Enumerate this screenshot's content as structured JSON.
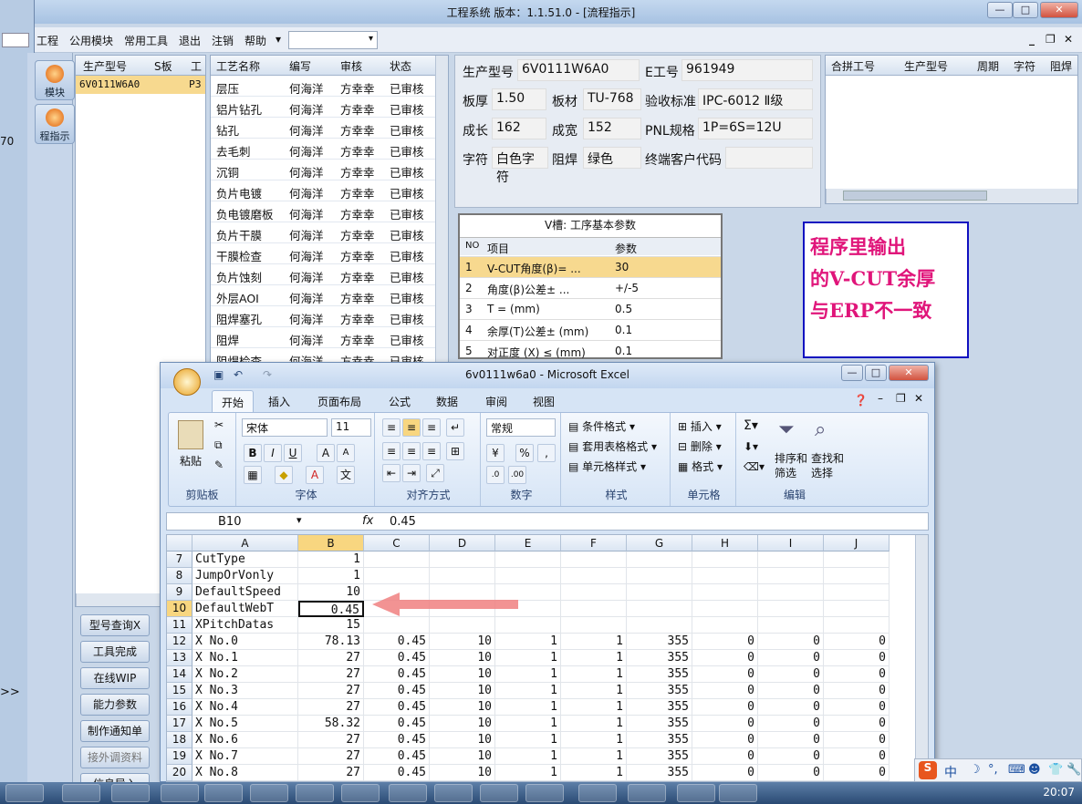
{
  "window": {
    "title": "工程系统   版本：1.1.51.0 - [流程指示]",
    "btn_min": "—",
    "btn_max": "□",
    "btn_close": "✕"
  },
  "menu": {
    "items": [
      "工程",
      "公用模块",
      "常用工具",
      "退出",
      "注销",
      "帮助"
    ]
  },
  "sidebar": {
    "items": [
      "模块",
      "程指示"
    ]
  },
  "left_overlay": {
    "text1": "70",
    "text2": ">>"
  },
  "model_list": {
    "headers": [
      "生产型号",
      "S板",
      "工"
    ],
    "row": {
      "model": "6V0111W6A0",
      "s": "P3"
    }
  },
  "process_table": {
    "headers": [
      "工艺名称",
      "编写",
      "审核",
      "状态"
    ],
    "rows": [
      [
        "层压",
        "何海洋",
        "方幸幸",
        "已审核"
      ],
      [
        "铝片钻孔",
        "何海洋",
        "方幸幸",
        "已审核"
      ],
      [
        "钻孔",
        "何海洋",
        "方幸幸",
        "已审核"
      ],
      [
        "去毛刺",
        "何海洋",
        "方幸幸",
        "已审核"
      ],
      [
        "沉铜",
        "何海洋",
        "方幸幸",
        "已审核"
      ],
      [
        "负片电镀",
        "何海洋",
        "方幸幸",
        "已审核"
      ],
      [
        "负电镀磨板",
        "何海洋",
        "方幸幸",
        "已审核"
      ],
      [
        "负片干膜",
        "何海洋",
        "方幸幸",
        "已审核"
      ],
      [
        "干膜检查",
        "何海洋",
        "方幸幸",
        "已审核"
      ],
      [
        "负片蚀刻",
        "何海洋",
        "方幸幸",
        "已审核"
      ],
      [
        "外层AOI",
        "何海洋",
        "方幸幸",
        "已审核"
      ],
      [
        "阻焊塞孔",
        "何海洋",
        "方幸幸",
        "已审核"
      ],
      [
        "阻焊",
        "何海洋",
        "方幸幸",
        "已审核"
      ],
      [
        "阻焊检查",
        "何海洋",
        "方幸幸",
        "已审核"
      ]
    ]
  },
  "info": {
    "model_label": "生产型号",
    "model_value": "6V0111W6A0",
    "e_label": "E工号",
    "e_value": "961949",
    "thick_label": "板厚",
    "thick_value": "1.50",
    "board_label": "板材",
    "board_value": "TU-768",
    "std_label": "验收标准",
    "std_value": "IPC-6012 Ⅱ级",
    "len_label": "成长",
    "len_value": "162",
    "width_label": "成宽",
    "width_value": "152",
    "pnl_label": "PNL规格",
    "pnl_value": "1P=6S=12U",
    "char_label": "字符",
    "char_value": "白色字符",
    "mask_label": "阻焊",
    "mask_value": "绿色",
    "cust_label": "终端客户代码",
    "cust_value": ""
  },
  "right_grid": {
    "headers": [
      "合拼工号",
      "生产型号",
      "周期",
      "字符",
      "阻焊"
    ]
  },
  "vcut": {
    "title": "V槽: 工序基本参数",
    "headers": [
      "NO",
      "项目",
      "参数"
    ],
    "rows": [
      [
        "1",
        "V-CUT角度(β)=  ...",
        "30"
      ],
      [
        "2",
        "角度(β)公差±  ...",
        "+/-5"
      ],
      [
        "3",
        "T =  (mm)",
        "0.5"
      ],
      [
        "4",
        "余厚(T)公差±  (mm)",
        "0.1"
      ],
      [
        "5",
        "对正度 (X) ≤ (mm)",
        "0.1"
      ]
    ]
  },
  "note": {
    "lines": [
      "程序里输出",
      "的V-CUT余厚",
      "与ERP不一致"
    ]
  },
  "left_buttons": [
    "型号查询X",
    "工具完成",
    "在线WIP",
    "能力参数",
    "制作通知单",
    "接外调资料",
    "信息导入"
  ],
  "excel": {
    "title": "6v0111w6a0 - Microsoft Excel",
    "tabs": [
      "开始",
      "插入",
      "页面布局",
      "公式",
      "数据",
      "审阅",
      "视图"
    ],
    "groups": [
      "剪贴板",
      "字体",
      "对齐方式",
      "数字",
      "样式",
      "单元格",
      "编辑"
    ],
    "font_name": "宋体",
    "font_size": "11",
    "num_format": "常规",
    "paste": "粘贴",
    "style_items": [
      "条件格式",
      "套用表格格式",
      "单元格样式"
    ],
    "cell_items": [
      "插入",
      "删除",
      "格式"
    ],
    "edit_items": [
      "排序和筛选",
      "查找和选择"
    ],
    "name_box": "B10",
    "formula": "0.45",
    "columns": [
      "A",
      "B",
      "C",
      "D",
      "E",
      "F",
      "G",
      "H",
      "I",
      "J"
    ],
    "rows": [
      {
        "n": "7",
        "a": "CutType",
        "b": "1",
        "c": "",
        "d": "",
        "e": "",
        "f": "",
        "g": "",
        "h": "",
        "i": "",
        "j": ""
      },
      {
        "n": "8",
        "a": "JumpOrVonly",
        "b": "1",
        "c": "",
        "d": "",
        "e": "",
        "f": "",
        "g": "",
        "h": "",
        "i": "",
        "j": ""
      },
      {
        "n": "9",
        "a": "DefaultSpeed",
        "b": "10",
        "c": "",
        "d": "",
        "e": "",
        "f": "",
        "g": "",
        "h": "",
        "i": "",
        "j": ""
      },
      {
        "n": "10",
        "a": "DefaultWebT",
        "b": "0.45",
        "c": "",
        "d": "",
        "e": "",
        "f": "",
        "g": "",
        "h": "",
        "i": "",
        "j": ""
      },
      {
        "n": "11",
        "a": "XPitchDatas",
        "b": "15",
        "c": "",
        "d": "",
        "e": "",
        "f": "",
        "g": "",
        "h": "",
        "i": "",
        "j": ""
      },
      {
        "n": "12",
        "a": "X No.0",
        "b": "78.13",
        "c": "0.45",
        "d": "10",
        "e": "1",
        "f": "1",
        "g": "355",
        "h": "0",
        "i": "0",
        "j": "0"
      },
      {
        "n": "13",
        "a": "X No.1",
        "b": "27",
        "c": "0.45",
        "d": "10",
        "e": "1",
        "f": "1",
        "g": "355",
        "h": "0",
        "i": "0",
        "j": "0"
      },
      {
        "n": "14",
        "a": "X No.2",
        "b": "27",
        "c": "0.45",
        "d": "10",
        "e": "1",
        "f": "1",
        "g": "355",
        "h": "0",
        "i": "0",
        "j": "0"
      },
      {
        "n": "15",
        "a": "X No.3",
        "b": "27",
        "c": "0.45",
        "d": "10",
        "e": "1",
        "f": "1",
        "g": "355",
        "h": "0",
        "i": "0",
        "j": "0"
      },
      {
        "n": "16",
        "a": "X No.4",
        "b": "27",
        "c": "0.45",
        "d": "10",
        "e": "1",
        "f": "1",
        "g": "355",
        "h": "0",
        "i": "0",
        "j": "0"
      },
      {
        "n": "17",
        "a": "X No.5",
        "b": "58.32",
        "c": "0.45",
        "d": "10",
        "e": "1",
        "f": "1",
        "g": "355",
        "h": "0",
        "i": "0",
        "j": "0"
      },
      {
        "n": "18",
        "a": "X No.6",
        "b": "27",
        "c": "0.45",
        "d": "10",
        "e": "1",
        "f": "1",
        "g": "355",
        "h": "0",
        "i": "0",
        "j": "0"
      },
      {
        "n": "19",
        "a": "X No.7",
        "b": "27",
        "c": "0.45",
        "d": "10",
        "e": "1",
        "f": "1",
        "g": "355",
        "h": "0",
        "i": "0",
        "j": "0"
      },
      {
        "n": "20",
        "a": "X No.8",
        "b": "27",
        "c": "0.45",
        "d": "10",
        "e": "1",
        "f": "1",
        "g": "355",
        "h": "0",
        "i": "0",
        "j": "0"
      }
    ]
  },
  "taskbar": {
    "time": "20:07"
  },
  "ime": {
    "label": "中"
  },
  "colors": {
    "note_text": "#e0157a",
    "note_border": "#1010c0",
    "arrow": "#f08080",
    "selected_row": "#f7d98f"
  }
}
